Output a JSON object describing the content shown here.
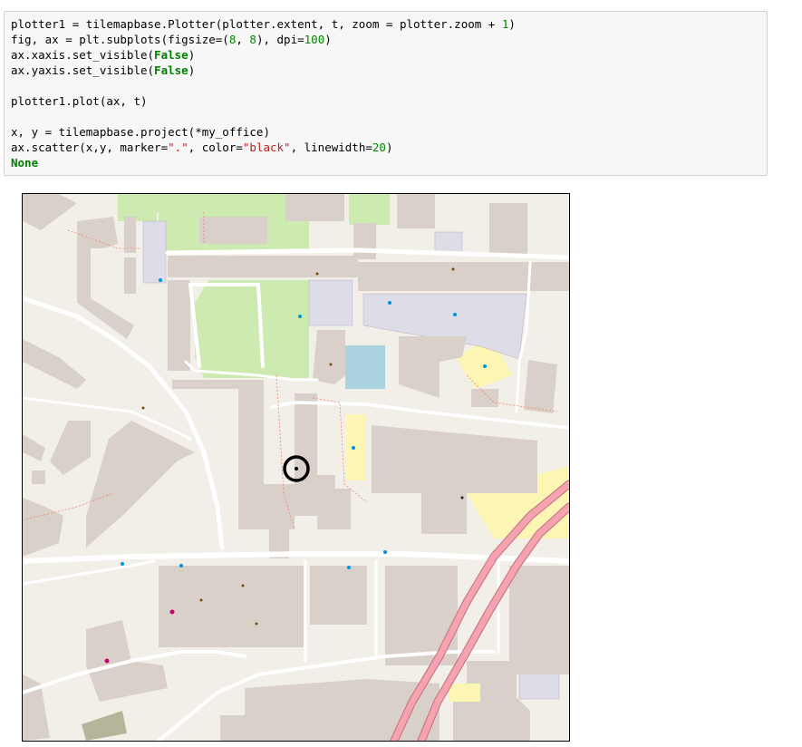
{
  "code_cell": {
    "lines": [
      [
        {
          "t": "plotter1 = tilemapbase.Plotter(plotter.extent, t, zoom = plotter.zoom + "
        },
        {
          "t": "1",
          "c": "num"
        },
        {
          "t": ")"
        }
      ],
      [
        {
          "t": "fig, ax = plt.subplots(figsize=("
        },
        {
          "t": "8",
          "c": "num"
        },
        {
          "t": ", "
        },
        {
          "t": "8",
          "c": "num"
        },
        {
          "t": "), dpi="
        },
        {
          "t": "100",
          "c": "num"
        },
        {
          "t": ")"
        }
      ],
      [
        {
          "t": "ax.xaxis.set_visible("
        },
        {
          "t": "False",
          "c": "kw"
        },
        {
          "t": ")"
        }
      ],
      [
        {
          "t": "ax.yaxis.set_visible("
        },
        {
          "t": "False",
          "c": "kw"
        },
        {
          "t": ")"
        }
      ],
      [
        {
          "t": ""
        }
      ],
      [
        {
          "t": "plotter1.plot(ax, t)"
        }
      ],
      [
        {
          "t": ""
        }
      ],
      [
        {
          "t": "x, y = tilemapbase.project(*my_office)"
        }
      ],
      [
        {
          "t": "ax.scatter(x,y, marker="
        },
        {
          "t": "\".\"",
          "c": "str"
        },
        {
          "t": ", color="
        },
        {
          "t": "\"black\"",
          "c": "str"
        },
        {
          "t": ", linewidth="
        },
        {
          "t": "20",
          "c": "num"
        },
        {
          "t": ")"
        }
      ],
      [
        {
          "t": "None",
          "c": "kw"
        }
      ]
    ]
  },
  "output": {
    "marker_color": "#000000",
    "colors": {
      "land": "#f2efe9",
      "building": "#d9d0c9",
      "park": "#cdebb0",
      "parking": "#dddde8",
      "water": "#aad3df",
      "road": "#ffffff",
      "path": "#fa8072",
      "primary": "#f6a3b0",
      "pedestrian": "#fcf5b4"
    }
  }
}
